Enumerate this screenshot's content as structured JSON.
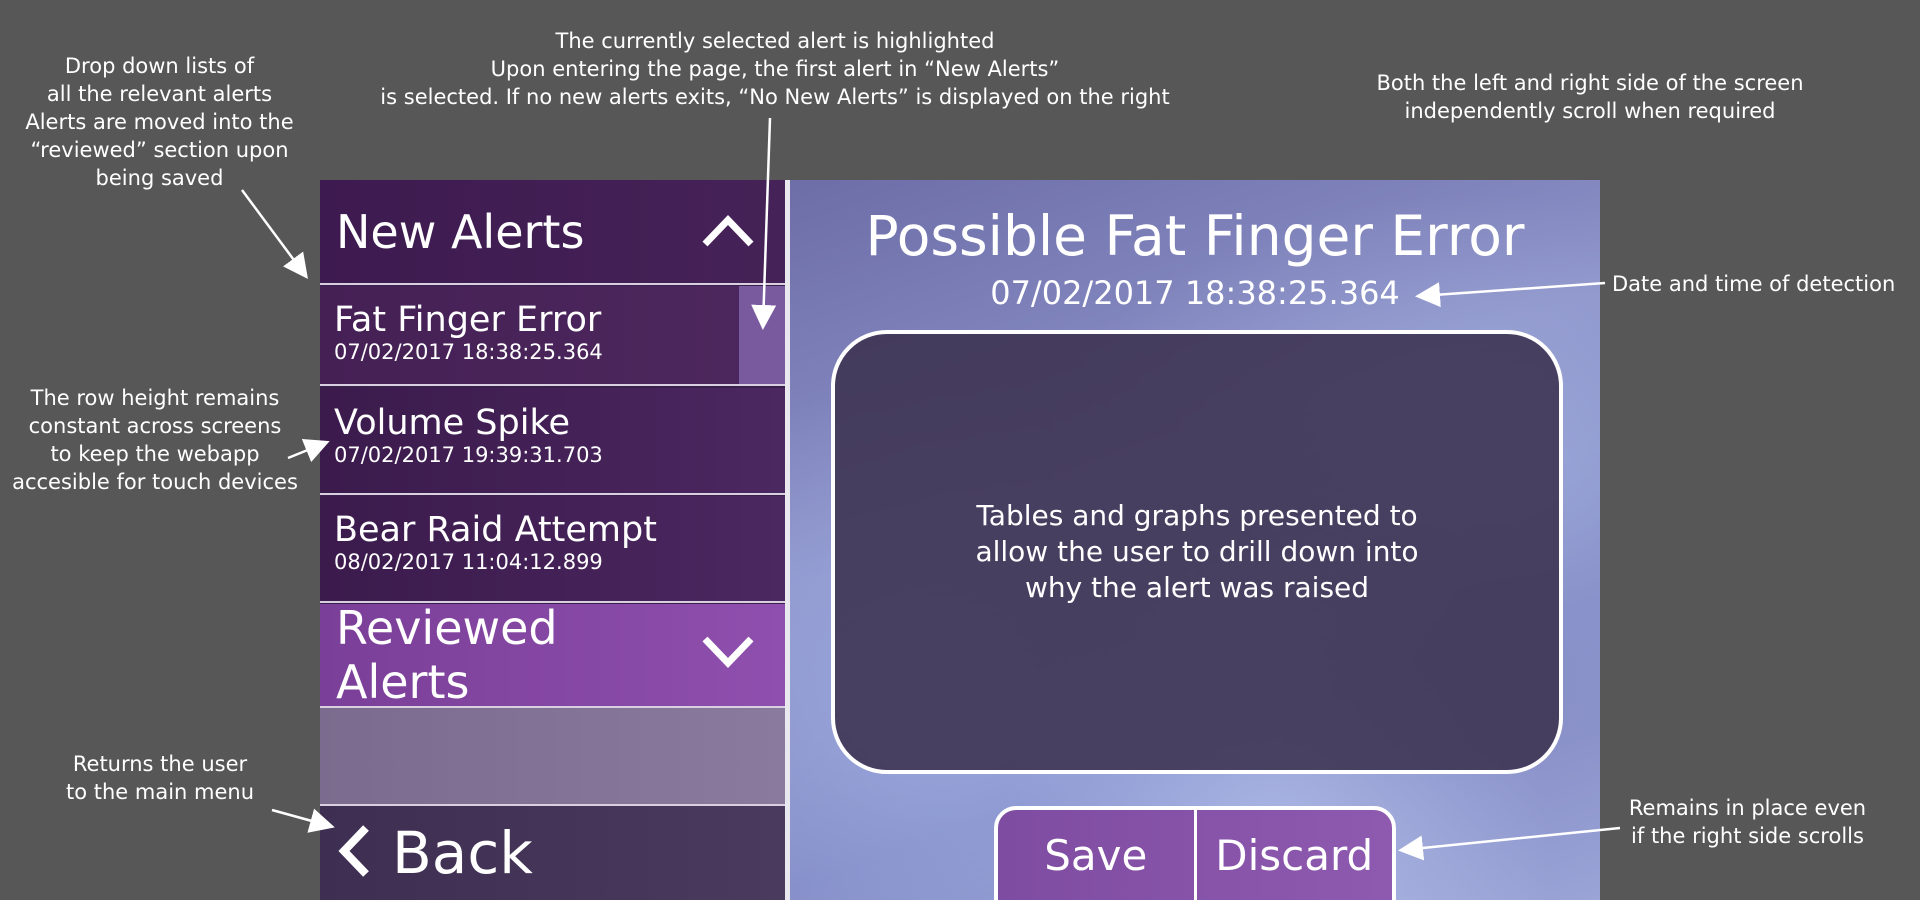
{
  "annotations": {
    "dropdown": [
      "Drop down lists of",
      "all the relevant alerts",
      "Alerts are moved into the",
      "“reviewed” section upon",
      "being saved"
    ],
    "selected": [
      "The currently selected alert is highlighted",
      "Upon entering the page, the first alert in “New Alerts”",
      "is selected. If no new alerts exits, “No New Alerts” is displayed on the right"
    ],
    "scroll": [
      "Both the left and right side of the screen",
      "independently scroll when required"
    ],
    "rowheight": [
      "The row height remains",
      "constant across screens",
      "to keep the webapp",
      "accesible for touch devices"
    ],
    "back": [
      "Returns the user",
      "to the main menu"
    ],
    "datetime": "Date and time of detection",
    "remains": [
      "Remains in place even",
      "if the right side scrolls"
    ]
  },
  "sidebar": {
    "new_alerts_title": "New Alerts",
    "reviewed_alerts_title": "Reviewed Alerts",
    "back_label": "Back",
    "alerts": [
      {
        "name": "Fat Finger Error",
        "timestamp": "07/02/2017 18:38:25.364",
        "selected": true
      },
      {
        "name": "Volume Spike",
        "timestamp": "07/02/2017 19:39:31.703",
        "selected": false
      },
      {
        "name": "Bear Raid Attempt",
        "timestamp": "08/02/2017 11:04:12.899",
        "selected": false
      }
    ]
  },
  "detail": {
    "title": "Possible Fat Finger Error",
    "timestamp": "07/02/2017 18:38:25.364",
    "content_lines": [
      "Tables and graphs presented to",
      "allow the user to drill down into",
      "why the alert was raised"
    ],
    "save_label": "Save",
    "discard_label": "Discard"
  },
  "colors": {
    "background": "#575757",
    "new_header": "#3d1a4f",
    "reviewed_header": "#8f4fae",
    "selected_indicator": "#7a5a9e",
    "action_bar": "#8e5ab0"
  },
  "icons": {
    "new_alerts_toggle": "chevron-up-icon",
    "reviewed_alerts_toggle": "chevron-down-icon",
    "back": "chevron-left-icon"
  }
}
